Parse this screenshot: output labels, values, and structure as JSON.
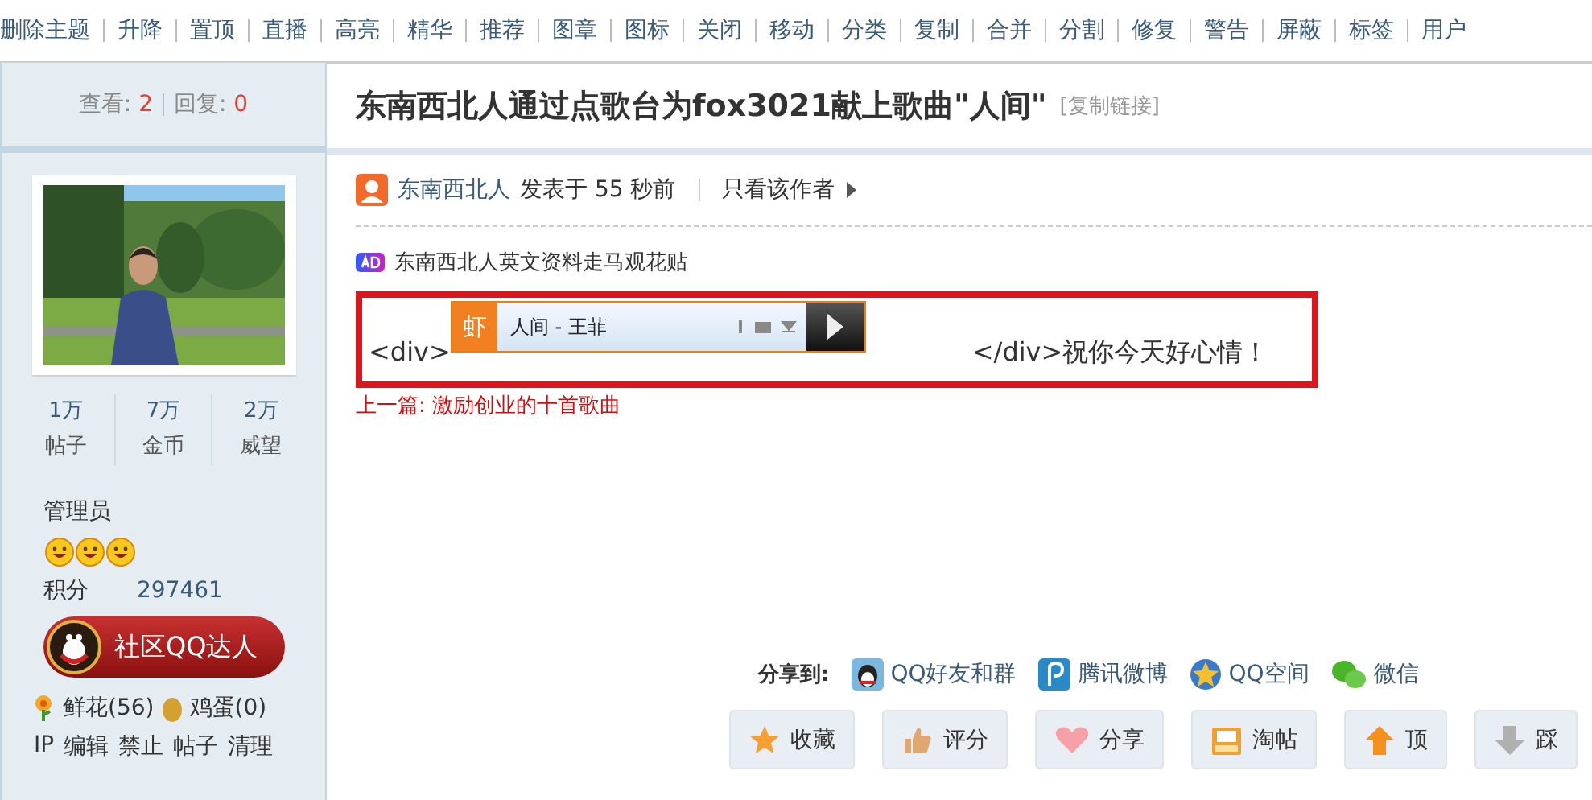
{
  "toolbar": [
    "删除主题",
    "升降",
    "置顶",
    "直播",
    "高亮",
    "精华",
    "推荐",
    "图章",
    "图标",
    "关闭",
    "移动",
    "分类",
    "复制",
    "合并",
    "分割",
    "修复",
    "警告",
    "屏蔽",
    "标签",
    "用户"
  ],
  "sidebar": {
    "views_label": "查看:",
    "views": "2",
    "replies_label": "回复:",
    "replies": "0",
    "photo": {
      "kind": "picture"
    },
    "stats": [
      {
        "value": "1万",
        "label": "帖子"
      },
      {
        "value": "7万",
        "label": "金币"
      },
      {
        "value": "2万",
        "label": "威望"
      }
    ],
    "group": "管理员",
    "points_label": "积分",
    "points": "297461",
    "badge": "社区QQ达人",
    "gifts": [
      {
        "kind": "flower",
        "label": "鲜花(56)"
      },
      {
        "kind": "egg",
        "label": "鸡蛋(0)"
      }
    ],
    "actions": [
      "IP",
      "编辑",
      "禁止",
      "帖子",
      "清理"
    ]
  },
  "post": {
    "title": "东南西北人通过点歌台为fox3021献上歌曲\"人间\"",
    "copy_link": "[复制链接]",
    "author": "东南西北人",
    "posted": "发表于 55 秒前",
    "only_author": "只看该作者",
    "ad": "东南西北人英文资料走马观花贴",
    "body_before": "<div>",
    "player": {
      "badge": "虾",
      "song": "人间 - 王菲"
    },
    "body_after": "</div>祝你今天好心情！",
    "prev": "上一篇: 激励创业的十首歌曲"
  },
  "share": {
    "label": "分享到:",
    "targets": [
      {
        "kind": "qq",
        "label": "QQ好友和群"
      },
      {
        "kind": "weibo",
        "label": "腾讯微博"
      },
      {
        "kind": "qzone",
        "label": "QQ空间"
      },
      {
        "kind": "wechat",
        "label": "微信"
      }
    ],
    "actions": [
      {
        "kind": "star",
        "label": "收藏"
      },
      {
        "kind": "thumb",
        "label": "评分"
      },
      {
        "kind": "heart",
        "label": "分享"
      },
      {
        "kind": "tray",
        "label": "淘帖"
      },
      {
        "kind": "up",
        "label": "顶"
      },
      {
        "kind": "down",
        "label": "踩"
      }
    ]
  }
}
